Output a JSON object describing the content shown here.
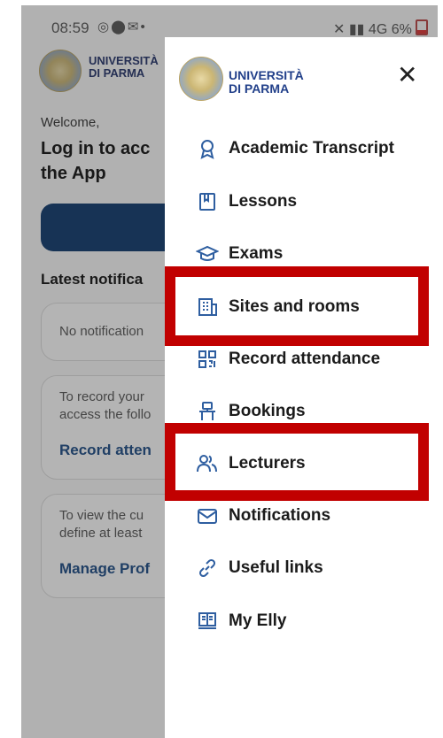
{
  "status_bar": {
    "time": "08:59",
    "right": "4G 6%"
  },
  "background": {
    "university": "UNIVERSITÀ\nDI PARMA",
    "welcome": "Welcome,",
    "title_line1": "Log in to acc",
    "title_line2": "the App",
    "latest": "Latest notifica",
    "card1_text": "No notification",
    "card2_text": "To record your\naccess the follo",
    "card2_link": "Record atten",
    "card3_text": "To view the cu\ndefine at least",
    "card3_link": "Manage Prof"
  },
  "drawer": {
    "university": "UNIVERSITÀ\nDI PARMA",
    "close": "✕",
    "items": [
      {
        "label": "Academic Transcript",
        "icon": "ribbon-icon"
      },
      {
        "label": "Lessons",
        "icon": "book-icon"
      },
      {
        "label": "Exams",
        "icon": "graduation-cap-icon"
      },
      {
        "label": "Sites and rooms",
        "icon": "building-icon"
      },
      {
        "label": "Record attendance",
        "icon": "qr-code-icon"
      },
      {
        "label": "Bookings",
        "icon": "desk-icon"
      },
      {
        "label": "Lecturers",
        "icon": "people-icon"
      },
      {
        "label": "Notifications",
        "icon": "mail-icon"
      },
      {
        "label": "Useful links",
        "icon": "link-icon"
      },
      {
        "label": "My Elly",
        "icon": "computer-book-icon"
      }
    ]
  },
  "colors": {
    "accent": "#2e5ea0",
    "highlight": "#c10000",
    "primary_button": "#0e3a6d"
  }
}
